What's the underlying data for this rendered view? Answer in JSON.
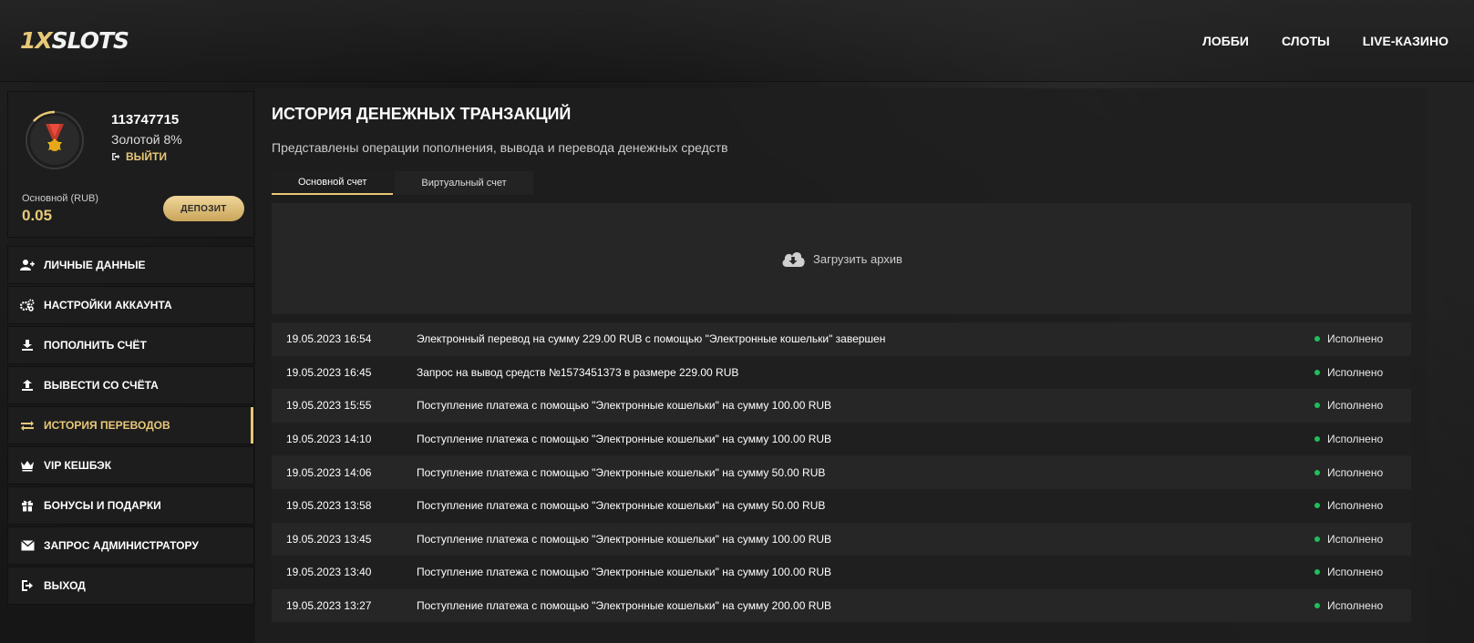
{
  "header": {
    "logo_part1": "1X",
    "logo_part2": "SLOTS",
    "nav": [
      "ЛОББИ",
      "СЛОТЫ",
      "LIVE-КАЗИНО"
    ]
  },
  "profile": {
    "user_id": "113747715",
    "level": "Золотой 8%",
    "logout": "ВЫЙТИ",
    "balance_label": "Основной (RUB)",
    "balance_value": "0.05",
    "deposit_button": "ДЕПОЗИТ",
    "level_progress": 0.08
  },
  "menu": [
    {
      "label": "ЛИЧНЫЕ ДАННЫЕ",
      "icon": "user-plus-icon"
    },
    {
      "label": "НАСТРОЙКИ АККАУНТА",
      "icon": "gears-icon"
    },
    {
      "label": "ПОПОЛНИТЬ СЧЁТ",
      "icon": "download-icon"
    },
    {
      "label": "ВЫВЕСТИ СО СЧЁТА",
      "icon": "upload-icon"
    },
    {
      "label": "ИСТОРИЯ ПЕРЕВОДОВ",
      "icon": "transfer-icon",
      "active": true
    },
    {
      "label": "VIP КЕШБЭК",
      "icon": "crown-icon"
    },
    {
      "label": "БОНУСЫ И ПОДАРКИ",
      "icon": "gift-icon"
    },
    {
      "label": "ЗАПРОС АДМИНИСТРАТОРУ",
      "icon": "envelope-icon"
    },
    {
      "label": "ВЫХОД",
      "icon": "logout-icon"
    }
  ],
  "main": {
    "title": "ИСТОРИЯ ДЕНЕЖНЫХ ТРАНЗАКЦИЙ",
    "subtitle": "Представлены операции пополнения, вывода и перевода денежных средств",
    "tabs": [
      "Основной счет",
      "Виртуальный счет"
    ],
    "upload_label": "Загрузить архив"
  },
  "transactions": [
    {
      "date": "19.05.2023 16:54",
      "desc": "Электронный перевод на сумму 229.00 RUB с помощью \"Электронные кошельки\" завершен",
      "status": "Исполнено"
    },
    {
      "date": "19.05.2023 16:45",
      "desc": "Запрос на вывод средств №1573451373 в размере 229.00 RUB",
      "status": "Исполнено"
    },
    {
      "date": "19.05.2023 15:55",
      "desc": "Поступление платежа с помощью \"Электронные кошельки\" на сумму 100.00 RUB",
      "status": "Исполнено"
    },
    {
      "date": "19.05.2023 14:10",
      "desc": "Поступление платежа с помощью \"Электронные кошельки\" на сумму 100.00 RUB",
      "status": "Исполнено"
    },
    {
      "date": "19.05.2023 14:06",
      "desc": "Поступление платежа с помощью \"Электронные кошельки\" на сумму 50.00 RUB",
      "status": "Исполнено"
    },
    {
      "date": "19.05.2023 13:58",
      "desc": "Поступление платежа с помощью \"Электронные кошельки\" на сумму 50.00 RUB",
      "status": "Исполнено"
    },
    {
      "date": "19.05.2023 13:45",
      "desc": "Поступление платежа с помощью \"Электронные кошельки\" на сумму 100.00 RUB",
      "status": "Исполнено"
    },
    {
      "date": "19.05.2023 13:40",
      "desc": "Поступление платежа с помощью \"Электронные кошельки\" на сумму 100.00 RUB",
      "status": "Исполнено"
    },
    {
      "date": "19.05.2023 13:27",
      "desc": "Поступление платежа с помощью \"Электронные кошельки\" на сумму 200.00 RUB",
      "status": "Исполнено"
    }
  ],
  "colors": {
    "accent": "#e8c878",
    "status_ok": "#1fbf5a"
  }
}
